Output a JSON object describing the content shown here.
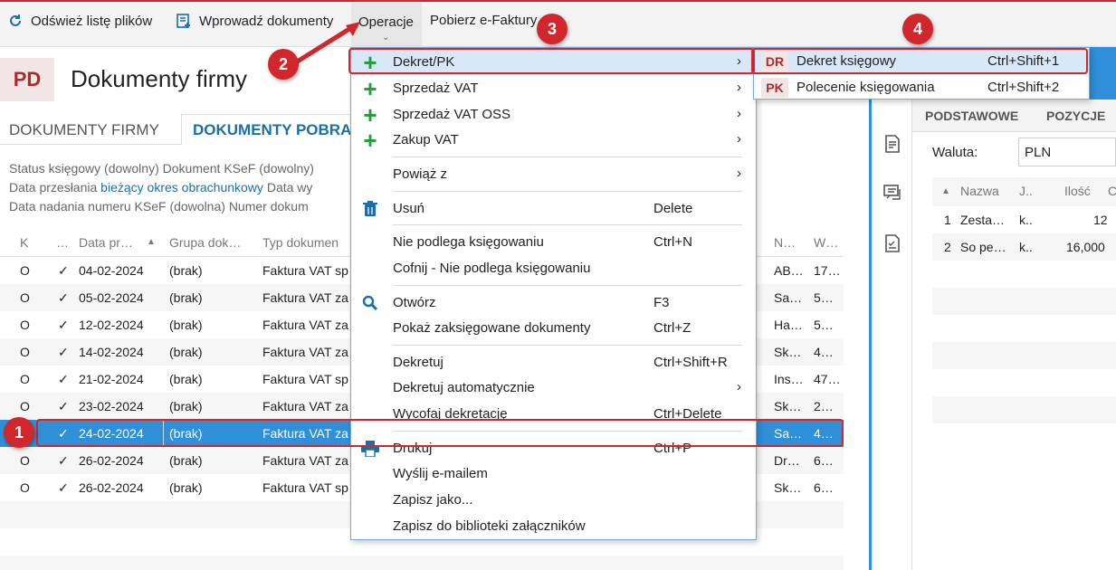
{
  "toolbar": {
    "refresh": "Odśwież listę plików",
    "import": "Wprowadź dokumenty",
    "operations": "Operacje",
    "download": "Pobierz e-Faktury"
  },
  "header": {
    "badge": "PD",
    "title": "Dokumenty firmy"
  },
  "tabs": [
    "DOKUMENTY FIRMY",
    "DOKUMENTY POBRA"
  ],
  "filters": {
    "line1a": "Status księgowy (dowolny)",
    "line1b": "Dokument KSeF (dowolny)",
    "line2a": "Data przesłania",
    "line2link": "bieżący okres obrachunkowy",
    "line2b": "Data wy",
    "line3a": "Data nadania numeru KSeF (dowolna)",
    "line3b": "Numer dokum"
  },
  "grid": {
    "headers": [
      "K",
      "…",
      "Data pr…",
      "Grupa dok…",
      "Typ dokumen",
      "N…",
      "W…"
    ],
    "rows": [
      {
        "k": "O",
        "c": "✓",
        "date": "04-02-2024",
        "group": "(brak)",
        "type": "Faktura VAT sp",
        "n": "AB…",
        "w": "17…"
      },
      {
        "k": "O",
        "c": "✓",
        "date": "05-02-2024",
        "group": "(brak)",
        "type": "Faktura VAT za",
        "n": "Sa…",
        "w": "5…"
      },
      {
        "k": "O",
        "c": "✓",
        "date": "12-02-2024",
        "group": "(brak)",
        "type": "Faktura VAT za",
        "n": "Ha…",
        "w": "5…"
      },
      {
        "k": "O",
        "c": "✓",
        "date": "14-02-2024",
        "group": "(brak)",
        "type": "Faktura VAT za",
        "n": "Sk…",
        "w": "4…"
      },
      {
        "k": "O",
        "c": "✓",
        "date": "21-02-2024",
        "group": "(brak)",
        "type": "Faktura VAT sp",
        "n": "Ins…",
        "w": "47…"
      },
      {
        "k": "O",
        "c": "✓",
        "date": "23-02-2024",
        "group": "(brak)",
        "type": "Faktura VAT za",
        "n": "Sk…",
        "w": "2…"
      },
      {
        "k": "",
        "c": "✓",
        "date": "24-02-2024",
        "group": "(brak)",
        "type": "Faktura VAT za",
        "n": "Sa…",
        "w": "4…"
      },
      {
        "k": "O",
        "c": "✓",
        "date": "26-02-2024",
        "group": "(brak)",
        "type": "Faktura VAT za",
        "n": "Dr…",
        "w": "6…"
      },
      {
        "k": "O",
        "c": "✓",
        "date": "26-02-2024",
        "group": "(brak)",
        "type": "Faktura VAT sp",
        "n": "Sk…",
        "w": "6…"
      }
    ],
    "selected_index": 6
  },
  "menu": {
    "items": [
      {
        "label": "Dekret/PK",
        "icon": "plus-icon",
        "submenu": true
      },
      {
        "label": "Sprzedaż VAT",
        "icon": "plus-icon",
        "submenu": true
      },
      {
        "label": "Sprzedaż VAT OSS",
        "icon": "plus-icon",
        "submenu": true
      },
      {
        "label": "Zakup VAT",
        "icon": "plus-icon",
        "submenu": true
      },
      {
        "label": "Powiąż z",
        "submenu": true
      },
      {
        "label": "Usuń",
        "icon": "trash-icon",
        "shortcut": "Delete"
      },
      {
        "label": "Nie podlega księgowaniu",
        "shortcut": "Ctrl+N"
      },
      {
        "label": "Cofnij - Nie podlega księgowaniu"
      },
      {
        "label": "Otwórz",
        "icon": "search-icon",
        "shortcut": "F3"
      },
      {
        "label": "Pokaż zaksięgowane dokumenty",
        "shortcut": "Ctrl+Z"
      },
      {
        "label": "Dekretuj",
        "shortcut": "Ctrl+Shift+R"
      },
      {
        "label": "Dekretuj automatycznie",
        "submenu": true
      },
      {
        "label": "Wycofaj dekretację",
        "shortcut": "Ctrl+Delete"
      },
      {
        "label": "Drukuj",
        "icon": "printer-icon",
        "shortcut": "Ctrl+P"
      },
      {
        "label": "Wyślij e-mailem"
      },
      {
        "label": "Zapisz jako..."
      },
      {
        "label": "Zapisz do biblioteki załączników"
      }
    ]
  },
  "submenu": {
    "items": [
      {
        "code": "DR",
        "label": "Dekret księgowy",
        "shortcut": "Ctrl+Shift+1"
      },
      {
        "code": "PK",
        "label": "Polecenie księgowania",
        "shortcut": "Ctrl+Shift+2"
      }
    ]
  },
  "right_panel": {
    "tabs": [
      "PODSTAWOWE",
      "POZYCJE"
    ],
    "currency_label": "Waluta:",
    "currency_value": "PLN",
    "headers": [
      "Nazwa",
      "J..",
      "Ilość",
      "C"
    ],
    "rows": [
      {
        "no": "1",
        "name": "Zesta…",
        "unit": "k..",
        "qty": "12"
      },
      {
        "no": "2",
        "name": "So pe…",
        "unit": "k..",
        "qty": "16,000"
      }
    ]
  },
  "markers": [
    "1",
    "2",
    "3",
    "4"
  ],
  "colors": {
    "accent": "#2f8fd8",
    "annotation": "#d0262c",
    "plus": "#1f9e3a"
  }
}
